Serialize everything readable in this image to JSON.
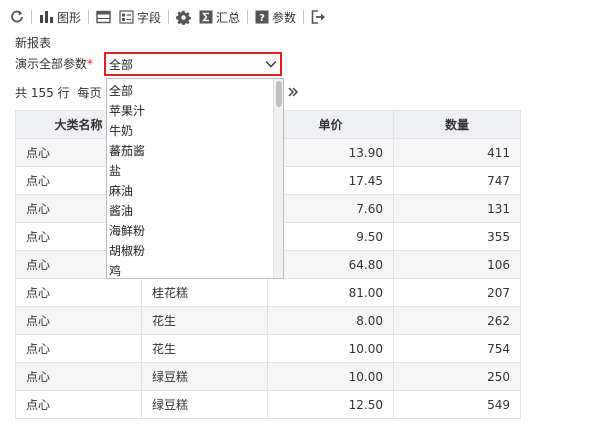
{
  "toolbar": {
    "items": [
      {
        "icon": "refresh-icon",
        "label": ""
      },
      {
        "icon": "chart-icon",
        "label": "图形"
      },
      {
        "icon": "table-icon",
        "label": ""
      },
      {
        "icon": "field-icon",
        "label": "字段"
      },
      {
        "icon": "gear-icon",
        "label": ""
      },
      {
        "icon": "sum-icon",
        "label": "汇总"
      },
      {
        "icon": "help-icon",
        "label": "参数"
      },
      {
        "icon": "export-icon",
        "label": ""
      }
    ]
  },
  "report_title": "新报表",
  "param": {
    "label": "演示全部参数",
    "required_mark": "*",
    "selected": "全部",
    "options": [
      "全部",
      "苹果汁",
      "牛奶",
      "蕃茄酱",
      "盐",
      "麻油",
      "酱油",
      "海鲜粉",
      "胡椒粉",
      "鸡"
    ]
  },
  "pager": {
    "total": "共 155 行",
    "per_page": "每页"
  },
  "table": {
    "headers": [
      "大类名称",
      "",
      "单价",
      "数量"
    ],
    "rows": [
      [
        "点心",
        "",
        "13.90",
        "411"
      ],
      [
        "点心",
        "",
        "17.45",
        "747"
      ],
      [
        "点心",
        "",
        "7.60",
        "131"
      ],
      [
        "点心",
        "",
        "9.50",
        "355"
      ],
      [
        "点心",
        "",
        "64.80",
        "106"
      ],
      [
        "点心",
        "桂花糕",
        "81.00",
        "207"
      ],
      [
        "点心",
        "花生",
        "8.00",
        "262"
      ],
      [
        "点心",
        "花生",
        "10.00",
        "754"
      ],
      [
        "点心",
        "绿豆糕",
        "10.00",
        "250"
      ],
      [
        "点心",
        "绿豆糕",
        "12.50",
        "549"
      ]
    ]
  },
  "colors": {
    "accent_border": "#e21f1f",
    "header_bg": "#eef0f4",
    "stripe": "#f6f6f6"
  }
}
